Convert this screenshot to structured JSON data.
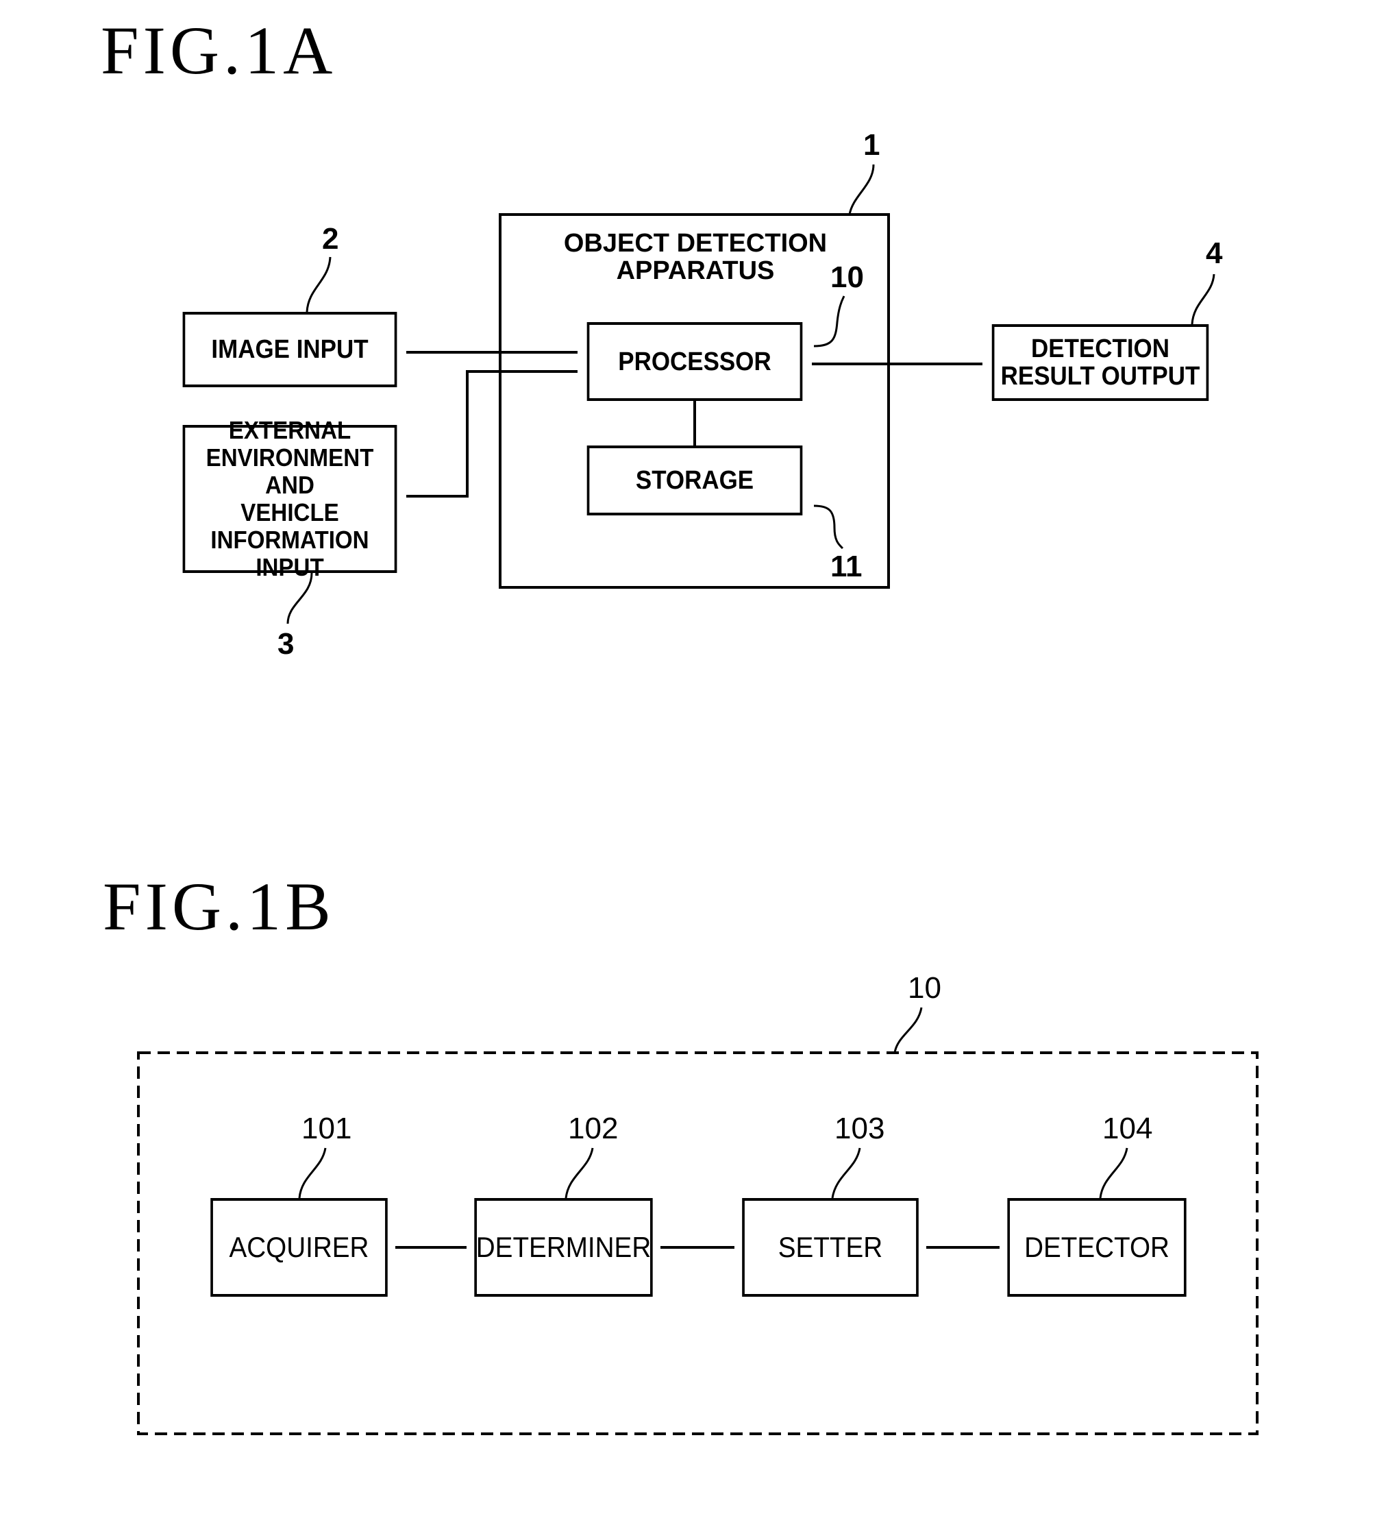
{
  "fig1a": {
    "title": "FIG.1A",
    "apparatus": {
      "ref": "1",
      "title_line1": "OBJECT DETECTION",
      "title_line2": "APPARATUS"
    },
    "processor": {
      "ref": "10",
      "label": "PROCESSOR"
    },
    "storage": {
      "ref": "11",
      "label": "STORAGE"
    },
    "image_input": {
      "ref": "2",
      "label": "IMAGE INPUT"
    },
    "external_input": {
      "ref": "3",
      "lines": [
        "EXTERNAL",
        "ENVIRONMENT AND",
        "VEHICLE",
        "INFORMATION INPUT"
      ]
    },
    "detection_output": {
      "ref": "4",
      "lines": [
        "DETECTION",
        "RESULT OUTPUT"
      ]
    }
  },
  "fig1b": {
    "title": "FIG.1B",
    "container_ref": "10",
    "blocks": [
      {
        "ref": "101",
        "label": "ACQUIRER"
      },
      {
        "ref": "102",
        "label": "DETERMINER"
      },
      {
        "ref": "103",
        "label": "SETTER"
      },
      {
        "ref": "104",
        "label": "DETECTOR"
      }
    ]
  }
}
